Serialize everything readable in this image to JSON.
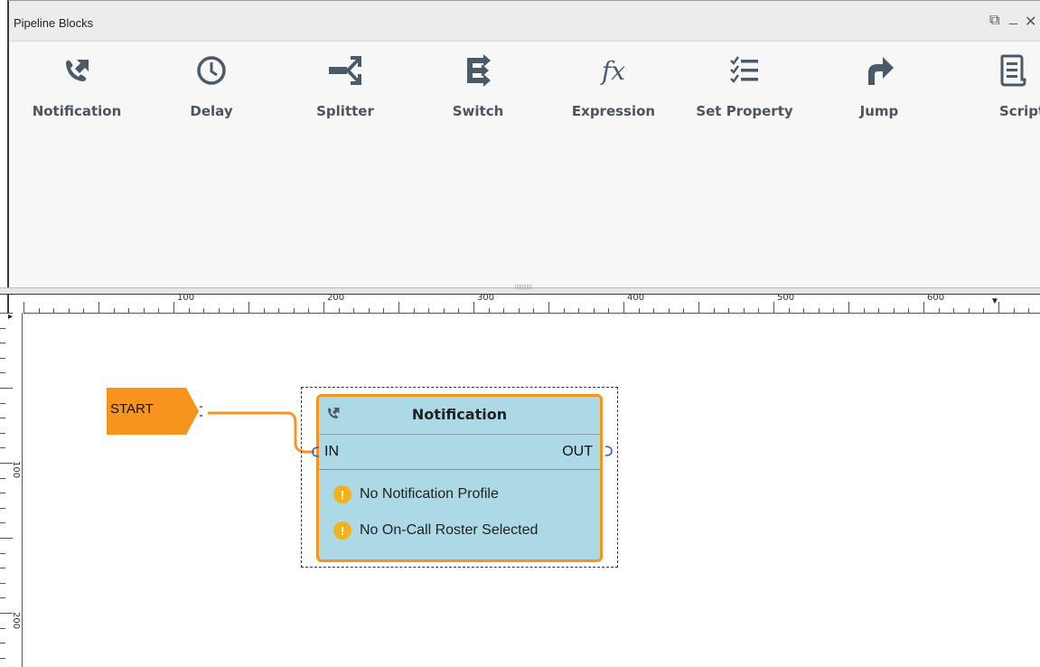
{
  "window": {
    "title": "Pipeline Blocks",
    "controls": {
      "restore": "⧉",
      "minimize": "_",
      "close": "✕"
    }
  },
  "palette": {
    "blocks": [
      {
        "label": "Notification",
        "icon": "notification-phone-icon"
      },
      {
        "label": "Delay",
        "icon": "clock-icon"
      },
      {
        "label": "Splitter",
        "icon": "splitter-icon"
      },
      {
        "label": "Switch",
        "icon": "switch-icon"
      },
      {
        "label": "Expression",
        "icon": "fx-icon",
        "glyph": "fx"
      },
      {
        "label": "Set Property",
        "icon": "checklist-icon"
      },
      {
        "label": "Jump",
        "icon": "jump-arrow-icon"
      },
      {
        "label": "Script",
        "icon": "script-icon"
      }
    ],
    "accent_color": "#4a5a68"
  },
  "ruler": {
    "horizontal_labels": [
      "100",
      "200",
      "300",
      "400",
      "500",
      "600"
    ],
    "vertical_labels": [
      "100",
      "200"
    ]
  },
  "diagram": {
    "start": {
      "label": "START",
      "color": "#f7941d"
    },
    "node": {
      "title": "Notification",
      "input_label": "IN",
      "output_label": "OUT",
      "warnings": [
        "No Notification Profile",
        "No On-Call Roster Selected"
      ],
      "fill_color": "#add8e6",
      "border_color": "#f7941d"
    }
  }
}
